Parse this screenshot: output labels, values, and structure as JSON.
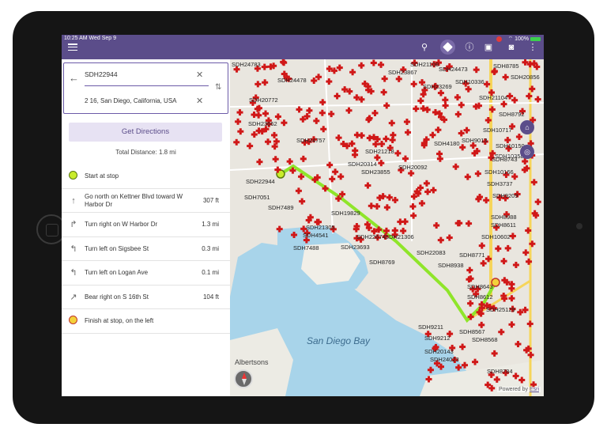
{
  "status_bar": {
    "time": "10:25 AM  Wed Sep 9",
    "battery": "100%"
  },
  "toolbar": {
    "menu_icon": "hamburger-icon",
    "icons": [
      "search-icon",
      "directions-icon",
      "info-icon",
      "bus-icon",
      "camera-icon",
      "more-vert-icon"
    ],
    "accent_color": "#5b4d8a"
  },
  "route_form": {
    "origin_value": "SDH22944",
    "destination_value": "2 16, San Diego, California, USA",
    "clear_glyph": "✕",
    "swap_glyph": "⇅",
    "back_glyph": "←"
  },
  "get_directions_label": "Get Directions",
  "total_distance": "Total Distance: 1.8 mi",
  "steps": [
    {
      "text": "Start at stop",
      "distance": "",
      "icon": "start-stop-icon"
    },
    {
      "text": "Go north on Kettner Blvd toward W Harbor Dr",
      "distance": "307 ft",
      "icon": "straight-arrow-icon"
    },
    {
      "text": "Turn right on W Harbor Dr",
      "distance": "1.3 mi",
      "icon": "turn-right-icon"
    },
    {
      "text": "Turn left on Sigsbee St",
      "distance": "0.3 mi",
      "icon": "turn-left-icon"
    },
    {
      "text": "Turn left on Logan Ave",
      "distance": "0.1 mi",
      "icon": "turn-left-icon"
    },
    {
      "text": "Bear right on S 16th St",
      "distance": "104 ft",
      "icon": "bear-right-icon"
    },
    {
      "text": "Finish at stop, on the left",
      "distance": "",
      "icon": "finish-stop-icon"
    }
  ],
  "map": {
    "water_label": "San Diego Bay",
    "area_label": "Albertsons",
    "attribution": "Powered by",
    "attribution_link": "Esri",
    "route_color": "#8fe52a",
    "marker_color": "#d01818",
    "stop_labels": [
      "SDH24783",
      "SDH22944",
      "SDH7051",
      "SDH7489",
      "SDH19829",
      "SDH21305",
      "SDH4541",
      "SDH22674",
      "SDH21306",
      "SDH7488",
      "SDH23693",
      "SDH8769",
      "SDH22083",
      "SDH8771",
      "SDH8938",
      "SDH8643",
      "SDH8612",
      "SDH25129",
      "SDH9211",
      "SDH8567",
      "SDH8568",
      "SDH9212",
      "SDH20143",
      "SDH24023",
      "SDH8784",
      "SDH8785",
      "SDH20856",
      "SDH10336",
      "SDH21104",
      "SDH8792",
      "SDH10717",
      "SDH10150",
      "SDH10358",
      "SDH10166",
      "SDH3737",
      "SDH9209",
      "SDH8988",
      "SDH8611",
      "SDH10602",
      "SDH23662",
      "SDH24757",
      "SDH20092",
      "SDH8743",
      "SDH9013",
      "SDH4180",
      "SDH21218",
      "SDH23855",
      "SDH20314",
      "SDH20772",
      "SDH24478",
      "SDH23867",
      "SDH24473",
      "SDH23269",
      "SDH21108"
    ]
  }
}
